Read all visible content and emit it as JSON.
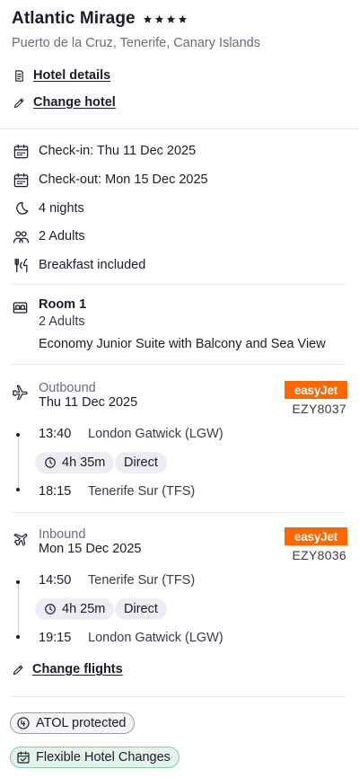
{
  "hotel": {
    "name": "Atlantic Mirage",
    "star_rating": 4,
    "location": "Puerto de la Cruz, Tenerife, Canary Islands",
    "details_link": "Hotel details",
    "change_link": "Change hotel"
  },
  "stay": {
    "checkin": "Check-in: Thu 11 Dec 2025",
    "checkout": "Check-out: Mon 15 Dec 2025",
    "nights": "4 nights",
    "guests": "2 Adults",
    "board": "Breakfast included"
  },
  "room": {
    "title": "Room 1",
    "adults": "2 Adults",
    "type": "Economy Junior Suite with Balcony and Sea View"
  },
  "outbound": {
    "direction": "Outbound",
    "date": "Thu 11 Dec 2025",
    "airline": "easyJet",
    "flight_number": "EZY8037",
    "depart_time": "13:40",
    "depart_airport": "London Gatwick (LGW)",
    "duration": "4h 35m",
    "stops": "Direct",
    "arrive_time": "18:15",
    "arrive_airport": "Tenerife Sur (TFS)"
  },
  "inbound": {
    "direction": "Inbound",
    "date": "Mon 15 Dec 2025",
    "airline": "easyJet",
    "flight_number": "EZY8036",
    "depart_time": "14:50",
    "depart_airport": "Tenerife Sur (TFS)",
    "duration": "4h 25m",
    "stops": "Direct",
    "arrive_time": "19:15",
    "arrive_airport": "London Gatwick (LGW)"
  },
  "change_flights_link": "Change flights",
  "badges": {
    "atol": "ATOL protected",
    "flexible": "Flexible Hotel Changes"
  },
  "colors": {
    "airline_brand": "#ff6600",
    "text": "#1c1c28",
    "muted": "#6b6b80",
    "flex_badge_bg": "#e3f3ea"
  },
  "icons": {
    "star": "star-icon",
    "details": "document-icon",
    "change": "pencil-icon",
    "calendar": "calendar-icon",
    "nights": "moon-icon",
    "guests": "people-icon",
    "board": "cutlery-icon",
    "room": "bed-icon",
    "outbound": "plane-icon",
    "inbound": "plane-icon",
    "duration": "clock-icon",
    "atol": "atol-icon",
    "flexible": "calendar-check-icon"
  }
}
